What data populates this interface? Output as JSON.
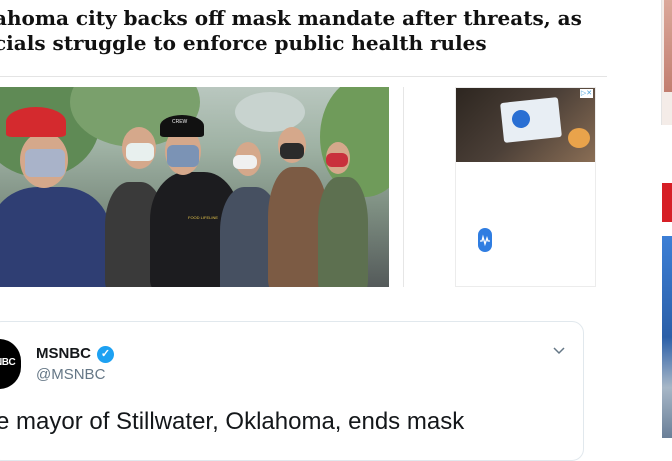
{
  "article": {
    "headline_line1": "ahoma city backs off mask mandate after threats, as",
    "headline_line2": "cials struggle to enforce public health rules",
    "photo_shirt_text_1": "CREW",
    "photo_shirt_text_2": "FOOD LIFELINE"
  },
  "ad": {
    "choices_label": "▷✕"
  },
  "tweet": {
    "avatar_text": "NBC",
    "display_name": "MSNBC",
    "handle": "@MSNBC",
    "body": "e mayor of Stillwater, Oklahoma, ends mask"
  },
  "colors": {
    "verified": "#1da1f2",
    "handle_gray": "#657786",
    "right_red": "#d61f26"
  },
  "icons": {
    "verified": "verified-badge-icon",
    "menu": "chevron-down-icon",
    "ad_choices": "ad-choices-icon"
  }
}
